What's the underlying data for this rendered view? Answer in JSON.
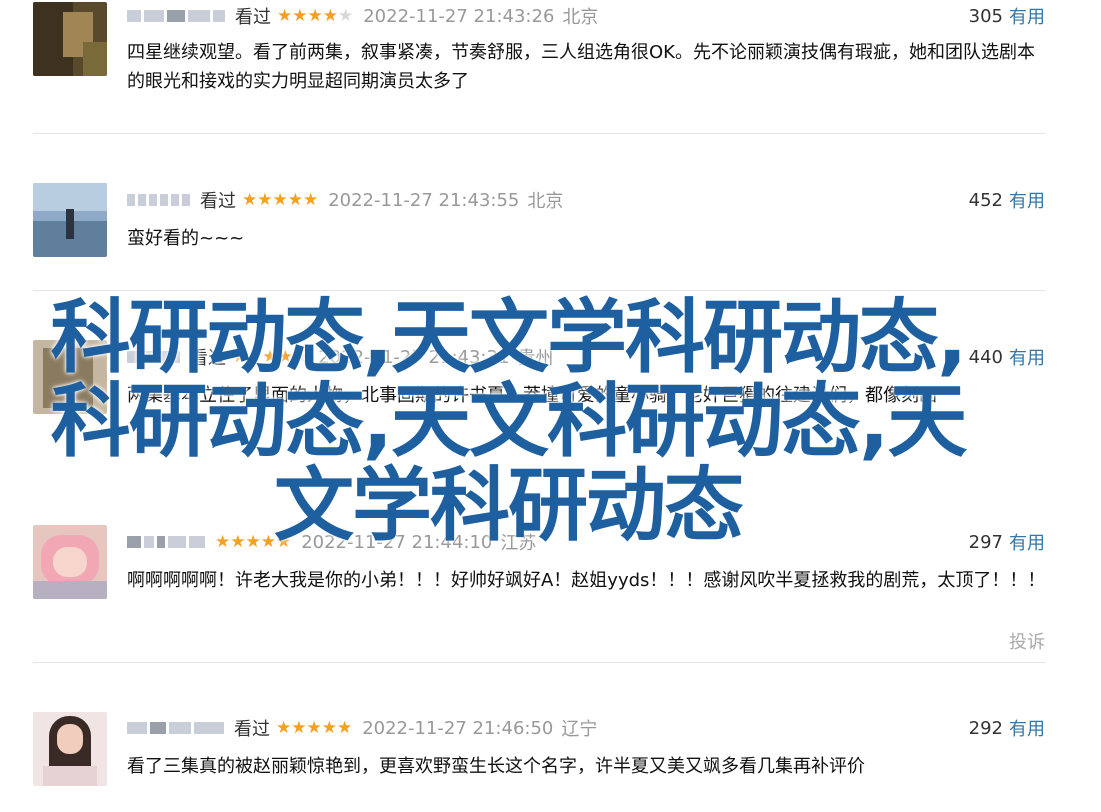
{
  "comments": [
    {
      "rating_label": "看过",
      "stars": "★★★★",
      "stars_off": "★",
      "time": "2022-11-27 21:43:26",
      "location": "北京",
      "votes": "305",
      "useful": "有用",
      "text": "四星继续观望。看了前两集，叙事紧凑，节奏舒服，三人组选角很OK。先不论丽颖演技偶有瑕疵，她和团队选剧本的眼光和接戏的实力明显超同期演员太多了"
    },
    {
      "rating_label": "看过",
      "stars": "★★★★★",
      "stars_off": "",
      "time": "2022-11-27 21:43:55",
      "location": "北京",
      "votes": "452",
      "useful": "有用",
      "text": "蛮好看的~~~"
    },
    {
      "rating_label": "看过",
      "stars": "★★★★",
      "stars_off": "★",
      "time": "2022-11-27 21:43:31",
      "location": "贵州",
      "votes": "440",
      "useful": "有用",
      "text": "两集基本立住了里面的人物，北事固期的许书夏，莽撞可爱的童小骑，老奸巨猾的往建设们，都像刻画"
    },
    {
      "rating_label": "",
      "stars": "★★★★★",
      "stars_off": "",
      "time": "2022-11-27 21:44:10",
      "location": "江苏",
      "votes": "297",
      "useful": "有用",
      "text": "啊啊啊啊啊！许老大我是你的小弟！！！好帅好飒好A！赵姐yyds！！！感谢风吹半夏拯救我的剧荒，太顶了！！！",
      "report": "投诉"
    },
    {
      "rating_label": "看过",
      "stars": "★★★★★",
      "stars_off": "",
      "time": "2022-11-27 21:46:50",
      "location": "辽宁",
      "votes": "292",
      "useful": "有用",
      "text": "看了三集真的被赵丽颖惊艳到，更喜欢野蛮生长这个名字，许半夏又美又飒多看几集再补评价"
    }
  ],
  "watermark": "科研动态,天文学科研动态,科研动态,天文科研动态,天文学科研动态",
  "colors": {
    "star": "#f4a020",
    "useful_link": "#3377aa",
    "watermark": "#1e5fa0",
    "meta_gray": "#999999"
  }
}
